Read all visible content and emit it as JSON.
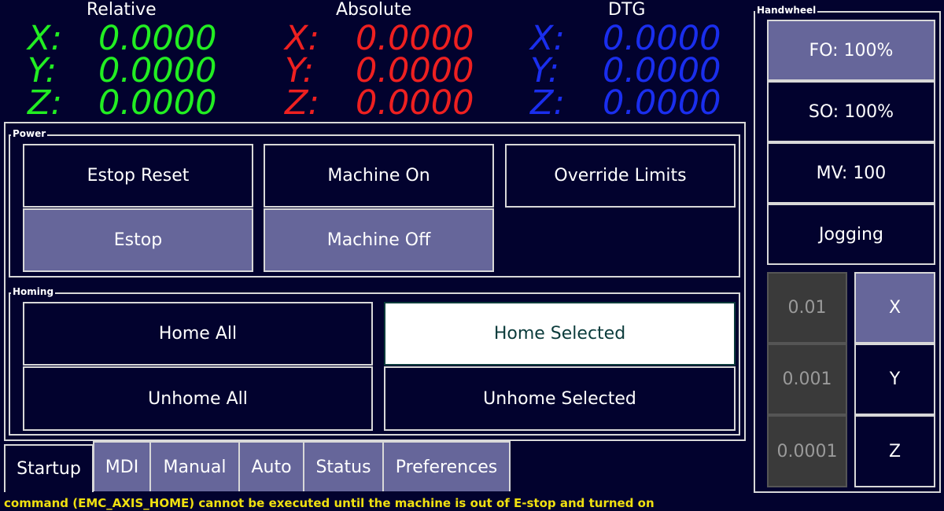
{
  "dro": {
    "relative": {
      "title": "Relative",
      "x_label": "X:",
      "y_label": "Y:",
      "z_label": "Z:",
      "x": "0.0000",
      "y": "0.0000",
      "z": "0.0000",
      "color": "#22ee22"
    },
    "absolute": {
      "title": "Absolute",
      "x_label": "X:",
      "y_label": "Y:",
      "z_label": "Z:",
      "x": "0.0000",
      "y": "0.0000",
      "z": "0.0000",
      "color": "#ee2020"
    },
    "dtg": {
      "title": "DTG",
      "x_label": "X:",
      "y_label": "Y:",
      "z_label": "Z:",
      "x": "0.0000",
      "y": "0.0000",
      "z": "0.0000",
      "color": "#1a2eee"
    }
  },
  "power": {
    "title": "Power",
    "estop_reset": "Estop Reset",
    "machine_on": "Machine On",
    "override_limits": "Override Limits",
    "estop": "Estop",
    "machine_off": "Machine Off"
  },
  "homing": {
    "title": "Homing",
    "home_all": "Home All",
    "home_selected": "Home Selected",
    "unhome_all": "Unhome All",
    "unhome_selected": "Unhome Selected"
  },
  "tabs": [
    "Startup",
    "MDI",
    "Manual",
    "Auto",
    "Status",
    "Preferences"
  ],
  "handwheel": {
    "title": "Handwheel",
    "fo": "FO: 100%",
    "so": "SO: 100%",
    "mv": "MV: 100",
    "jogging": "Jogging",
    "increments": [
      "0.01",
      "0.001",
      "0.0001"
    ],
    "axes": [
      "X",
      "Y",
      "Z"
    ]
  },
  "status_message": "command (EMC_AXIS_HOME) cannot be executed until the machine is out of E-stop and turned on",
  "colors": {
    "background": "#02022e",
    "active_button": "#66669a",
    "status_text": "#f0e010"
  }
}
